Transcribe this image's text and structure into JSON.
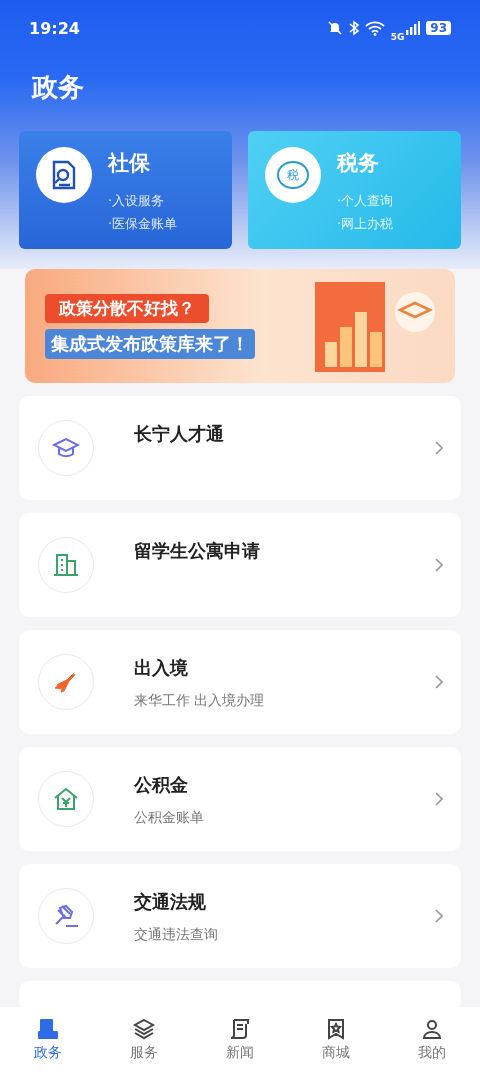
{
  "status_bar": {
    "time": "19:24",
    "network": "5G",
    "battery": "93"
  },
  "title": "政务",
  "cards": [
    {
      "kind": "social",
      "title": "社保",
      "links": [
        "·入设服务",
        "·医保金账单"
      ]
    },
    {
      "kind": "tax",
      "title": "税务",
      "badge": "税",
      "links": [
        "·个人查询",
        "·网上办税"
      ]
    }
  ],
  "banner": {
    "line_1": "政策分散不好找？",
    "line_2": "集成式发布政策库来了！"
  },
  "services": [
    {
      "kind": "cap",
      "title": "长宁人才通",
      "color": "#6b6fe0"
    },
    {
      "kind": "building",
      "title": "留学生公寓申请",
      "color": "#3aa56b"
    },
    {
      "kind": "plane",
      "title": "出入境",
      "subtitle": "来华工作 出入境办理",
      "color": "#f0642c"
    },
    {
      "kind": "house",
      "title": "公积金",
      "subtitle": "公积金账单",
      "color": "#3aa56b"
    },
    {
      "kind": "gavel",
      "title": "交通法规",
      "subtitle": "交通违法查询",
      "color": "#6b6fe0"
    }
  ],
  "tabs": [
    {
      "kind": "gov",
      "label": "政务",
      "selected": true
    },
    {
      "kind": "layers",
      "label": "服务",
      "selected": false
    },
    {
      "kind": "news",
      "label": "新闻",
      "selected": false
    },
    {
      "kind": "shop",
      "label": "商城",
      "selected": false
    },
    {
      "kind": "user",
      "label": "我的",
      "selected": false
    }
  ]
}
